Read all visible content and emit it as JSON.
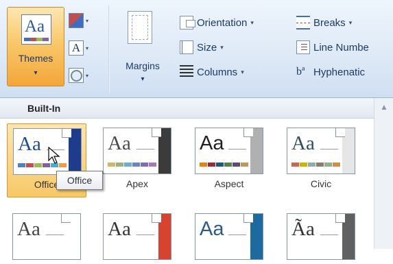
{
  "ribbon": {
    "themes": {
      "label": "Themes",
      "arrow": "▾",
      "doc_text": "Aa"
    },
    "theme_colors": {
      "icon": "theme-colors-icon",
      "arrow": "▾"
    },
    "theme_fonts": {
      "glyph": "A",
      "arrow": "▾"
    },
    "theme_effects": {
      "icon": "theme-effects-icon",
      "arrow": "▾"
    },
    "margins": {
      "label": "Margins",
      "arrow": "▾"
    },
    "orientation": {
      "label": "Orientation",
      "arrow": "▾"
    },
    "size": {
      "label": "Size",
      "arrow": "▾"
    },
    "columns": {
      "label": "Columns",
      "arrow": "▾"
    },
    "breaks": {
      "label": "Breaks",
      "arrow": "▾"
    },
    "line_numbers": {
      "label": "Line Numbe"
    },
    "hyphenation": {
      "label": "Hyphenatic",
      "glyph": "bª"
    }
  },
  "gallery": {
    "section_title": "Built-In",
    "scroll_up": "▲",
    "tooltip": "Office",
    "themes": [
      {
        "name": "Office",
        "text": "Aa",
        "accent": "#1f3c8c",
        "text_color": "#1f4d8f",
        "serif": true,
        "swatches": [
          "#4f81bd",
          "#c0504d",
          "#9bbb59",
          "#8064a2",
          "#4bacc6",
          "#f79646"
        ]
      },
      {
        "name": "Apex",
        "text": "Aa",
        "accent": "#3b3b3b",
        "text_color": "#4a4a4a",
        "serif": true,
        "swatches": [
          "#ceb966",
          "#9cb084",
          "#6bb1c9",
          "#6585cf",
          "#7e6bc9",
          "#a379bb"
        ]
      },
      {
        "name": "Aspect",
        "text": "Aa",
        "accent": "#b0b0b0",
        "text_color": "#222222",
        "serif": false,
        "swatches": [
          "#f07f09",
          "#9f2936",
          "#1b587c",
          "#4e8542",
          "#604878",
          "#c19859"
        ]
      },
      {
        "name": "Civic",
        "text": "Aa",
        "accent": "#e6e6e6",
        "text_color": "#2f4f5f",
        "serif": true,
        "swatches": [
          "#d16349",
          "#ccb400",
          "#8cadae",
          "#8c7b70",
          "#8fb08c",
          "#d19049"
        ]
      },
      {
        "name": "",
        "text": "Aa",
        "accent": "#ffffff",
        "text_color": "#444444",
        "serif": true,
        "swatches": []
      },
      {
        "name": "",
        "text": "Aa",
        "accent": "#d8432f",
        "text_color": "#333333",
        "serif": true,
        "swatches": []
      },
      {
        "name": "",
        "text": "Aa",
        "accent": "#1c6aa0",
        "text_color": "#2c5b85",
        "serif": false,
        "swatches": []
      },
      {
        "name": "",
        "text": "Ãa",
        "accent": "#606060",
        "text_color": "#333333",
        "serif": true,
        "swatches": []
      }
    ]
  }
}
